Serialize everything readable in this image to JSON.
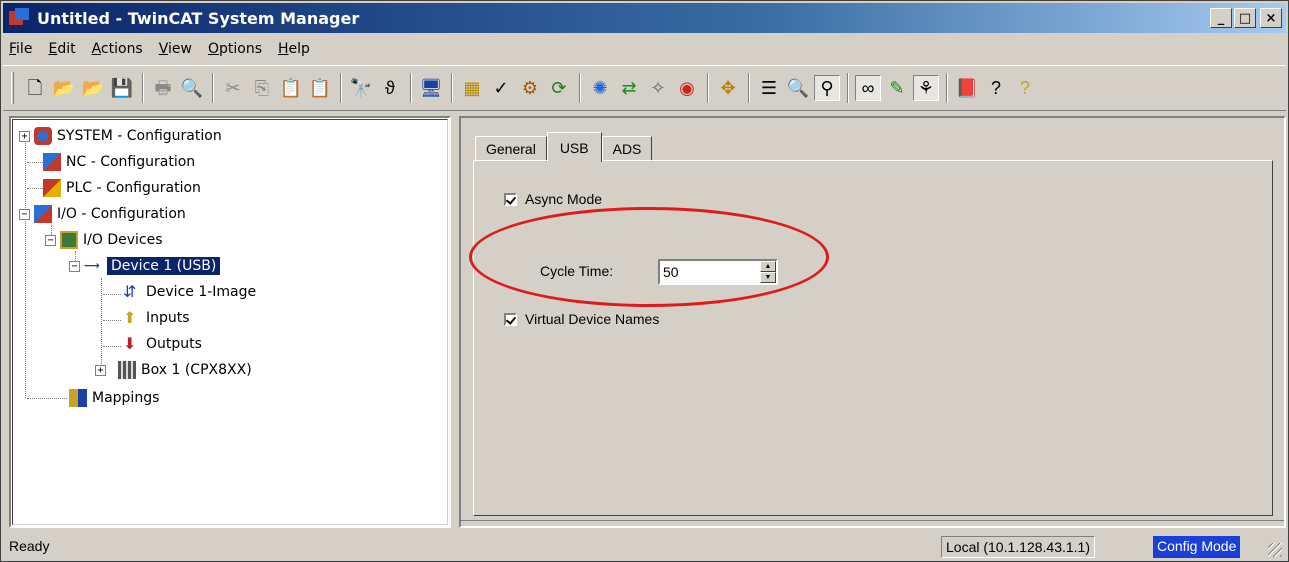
{
  "window": {
    "title": "Untitled - TwinCAT System Manager",
    "minimize": "_",
    "maximize": "□",
    "close": "×"
  },
  "menu": [
    {
      "label": "File",
      "ul": "F",
      "rest": "ile"
    },
    {
      "label": "Edit",
      "ul": "E",
      "rest": "dit"
    },
    {
      "label": "Actions",
      "ul": "A",
      "rest": "ctions"
    },
    {
      "label": "View",
      "ul": "V",
      "rest": "iew"
    },
    {
      "label": "Options",
      "ul": "O",
      "rest": "ptions"
    },
    {
      "label": "Help",
      "ul": "H",
      "rest": "elp"
    }
  ],
  "toolbar": {
    "icons": [
      "new-icon",
      "open-icon",
      "open-remote-icon",
      "save-icon",
      "print-icon",
      "print-preview-icon",
      "cut-icon",
      "copy-icon",
      "paste-icon",
      "paste-with-links-icon",
      "find-icon",
      "find-next-icon",
      "target-icon",
      "generate-mappings-icon",
      "check-configuration-icon",
      "activate-configuration-icon",
      "restart-icon",
      "reload-devices-icon",
      "scan-devices-icon",
      "toggle-freerun-icon",
      "reset-icon",
      "insert-icon",
      "show-sub-items-icon",
      "zoom-icon",
      "online-values-icon",
      "watch-icon",
      "marker-icon",
      "show-online-icon",
      "help-book-icon",
      "help-icon",
      "more-icon"
    ]
  },
  "tree": {
    "system": "SYSTEM - Configuration",
    "nc": "NC - Configuration",
    "plc": "PLC - Configuration",
    "io": "I/O - Configuration",
    "io_devices": "I/O Devices",
    "device1": "Device 1 (USB)",
    "device1_image": "Device 1-Image",
    "inputs": "Inputs",
    "outputs": "Outputs",
    "box1": "Box 1 (CPX8XX)",
    "mappings": "Mappings",
    "plus": "+",
    "minus": "−"
  },
  "tabs": {
    "general": "General",
    "usb": "USB",
    "ads": "ADS"
  },
  "usb": {
    "async_mode": "Async Mode",
    "async_checked": true,
    "cycle_time_label": "Cycle Time:",
    "cycle_time_value": "50",
    "virtual_names": "Virtual Device Names",
    "virtual_checked": true
  },
  "status": {
    "text": "Ready",
    "local": "Local (10.1.128.43.1.1)",
    "mode": "Config Mode"
  },
  "colors": {
    "titlebar": "#0a246a",
    "selection": "#0a246a",
    "highlight_ellipse": "#e01a1a",
    "config_mode": "#1a40d8"
  }
}
